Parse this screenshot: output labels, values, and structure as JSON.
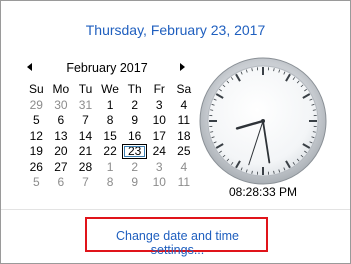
{
  "header": {
    "date_long": "Thursday, February 23, 2017"
  },
  "calendar": {
    "month_label": "February 2017",
    "weekdays": [
      "Su",
      "Mo",
      "Tu",
      "We",
      "Th",
      "Fr",
      "Sa"
    ],
    "weeks": [
      [
        "29",
        "30",
        "31",
        "1",
        "2",
        "3",
        "4"
      ],
      [
        "5",
        "6",
        "7",
        "8",
        "9",
        "10",
        "11"
      ],
      [
        "12",
        "13",
        "14",
        "15",
        "16",
        "17",
        "18"
      ],
      [
        "19",
        "20",
        "21",
        "22",
        "23",
        "24",
        "25"
      ],
      [
        "26",
        "27",
        "28",
        "1",
        "2",
        "3",
        "4"
      ],
      [
        "5",
        "6",
        "7",
        "8",
        "9",
        "10",
        "11"
      ]
    ],
    "today": "23"
  },
  "clock": {
    "digital": "08:28:33 PM"
  },
  "footer": {
    "link_label": "Change date and time settings..."
  },
  "colors": {
    "accent": "#1f5fbf",
    "highlight_box": "#e0141a"
  }
}
